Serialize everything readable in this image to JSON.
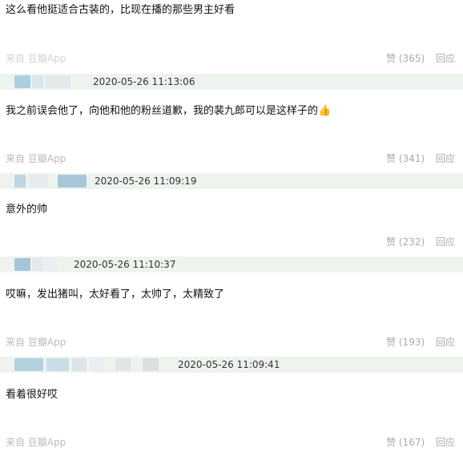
{
  "comments": [
    {
      "text": "这么看他挺适合古装的，比现在播的那些男主好看",
      "source": "来自 豆瓣App",
      "like": "赞 (365)",
      "reply": "回应"
    },
    {
      "timestamp": "2020-05-26 11:13:06",
      "text": "我之前误会他了，向他和他的粉丝道歉，我的裴九郎可以是这样子的",
      "emoji": "👍",
      "source": "来自 豆瓣App",
      "like": "赞 (341)",
      "reply": "回应"
    },
    {
      "timestamp": "2020-05-26 11:09:19",
      "text": "意外的帅",
      "like": "赞 (232)",
      "reply": "回应"
    },
    {
      "timestamp": "2020-05-26 11:10:37",
      "text": "哎嘛，发出猪叫，太好看了，太帅了，太精致了",
      "source": "来自 豆瓣App",
      "like": "赞 (193)",
      "reply": "回应"
    },
    {
      "timestamp": "2020-05-26 11:09:41",
      "text": "看着很好哎",
      "source": "来自 豆瓣App",
      "like": "赞 (167)",
      "reply": "回应"
    }
  ],
  "colors": {
    "header_bg": "#eef3ee",
    "muted_text": "#aaaaaa",
    "blur_avatar": "#9fc3d6"
  }
}
